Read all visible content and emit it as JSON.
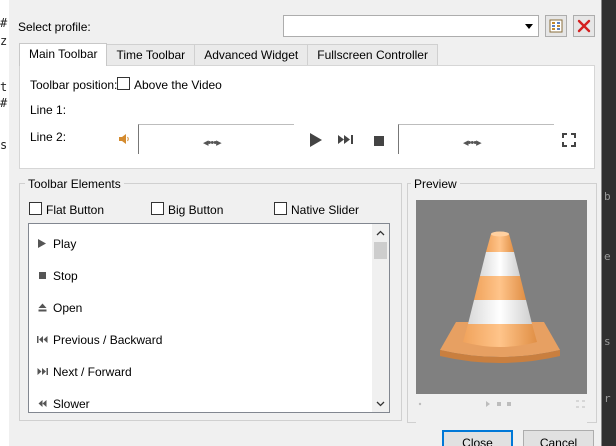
{
  "background_editor": {
    "left_fragments": [
      "#",
      "z",
      "t",
      "#",
      "s"
    ],
    "right_fragments": [
      "b",
      "e",
      "s",
      "r"
    ]
  },
  "profile": {
    "label": "Select profile:",
    "selected": "",
    "edit_icon": "edit-profile-icon",
    "delete_icon": "delete-profile-icon"
  },
  "tabs": [
    {
      "label": "Main Toolbar",
      "active": true
    },
    {
      "label": "Time Toolbar",
      "active": false
    },
    {
      "label": "Advanced Widget",
      "active": false
    },
    {
      "label": "Fullscreen Controller",
      "active": false
    }
  ],
  "main_toolbar": {
    "position_label": "Toolbar position:",
    "above_video_label": "Above the Video",
    "above_video_checked": false,
    "line1_label": "Line 1:",
    "line2_label": "Line 2:",
    "slider_handle": "◂•••▸",
    "line2_items": [
      "volume-icon",
      "seek-slider",
      "play-icon",
      "next-icon",
      "stop-icon",
      "volume-slider",
      "fullscreen-icon"
    ]
  },
  "toolbar_elements": {
    "title": "Toolbar Elements",
    "flat_button": "Flat Button",
    "big_button": "Big Button",
    "native_slider": "Native Slider",
    "items": [
      {
        "label": "Play",
        "icon": "play-icon"
      },
      {
        "label": "Stop",
        "icon": "stop-icon"
      },
      {
        "label": "Open",
        "icon": "eject-icon"
      },
      {
        "label": "Previous / Backward",
        "icon": "previous-icon"
      },
      {
        "label": "Next / Forward",
        "icon": "next-icon"
      },
      {
        "label": "Slower",
        "icon": "slower-icon"
      }
    ]
  },
  "preview": {
    "title": "Preview",
    "image": "vlc-cone-logo"
  },
  "buttons": {
    "close": "Close",
    "cancel": "Cancel"
  },
  "colors": {
    "dialog_bg": "#f0f0f0",
    "preview_bg": "#808080",
    "cone_orange": "#f5a962",
    "delete_red": "#d42020",
    "default_button_border": "#0078d7"
  }
}
